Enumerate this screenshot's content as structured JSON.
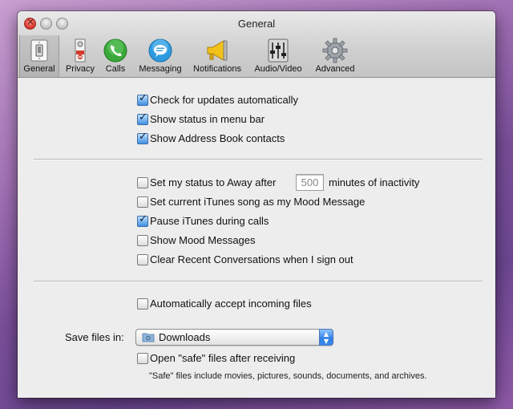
{
  "window": {
    "title": "General"
  },
  "tabs": [
    {
      "label": "General",
      "icon": "light-switch-icon",
      "selected": true
    },
    {
      "label": "Privacy",
      "icon": "door-hanger-icon",
      "selected": false
    },
    {
      "label": "Calls",
      "icon": "phone-icon",
      "selected": false
    },
    {
      "label": "Messaging",
      "icon": "speech-bubble-icon",
      "selected": false
    },
    {
      "label": "Notifications",
      "icon": "megaphone-icon",
      "selected": false
    },
    {
      "label": "Audio/Video",
      "icon": "mixer-icon",
      "selected": false
    },
    {
      "label": "Advanced",
      "icon": "gear-icon",
      "selected": false
    }
  ],
  "section1": {
    "check_updates": {
      "label": "Check for updates automatically",
      "checked": true
    },
    "status_menu_bar": {
      "label": "Show status in menu bar",
      "checked": true
    },
    "address_book": {
      "label": "Show Address Book contacts",
      "checked": true
    }
  },
  "section2": {
    "away_status": {
      "label_before": "Set my status to Away after",
      "value": "500",
      "label_after": "minutes of inactivity",
      "checked": false
    },
    "itunes_mood": {
      "label": "Set current iTunes song as my Mood Message",
      "checked": false
    },
    "pause_itunes": {
      "label": "Pause iTunes during calls",
      "checked": true
    },
    "show_mood": {
      "label": "Show Mood Messages",
      "checked": false
    },
    "clear_recent": {
      "label": "Clear Recent Conversations when I sign out",
      "checked": false
    }
  },
  "section3": {
    "auto_accept": {
      "label": "Automatically accept incoming files",
      "checked": false
    },
    "save_files": {
      "label": "Save files in:",
      "value": "Downloads"
    },
    "open_safe": {
      "label": "Open \"safe\" files after receiving",
      "checked": false
    },
    "safe_note": "\"Safe\" files include movies, pictures, sounds, documents, and archives."
  },
  "colors": {
    "accent": "#3f8fe0",
    "close_button": "#e0443a",
    "desktop": "#7a4f9a"
  }
}
